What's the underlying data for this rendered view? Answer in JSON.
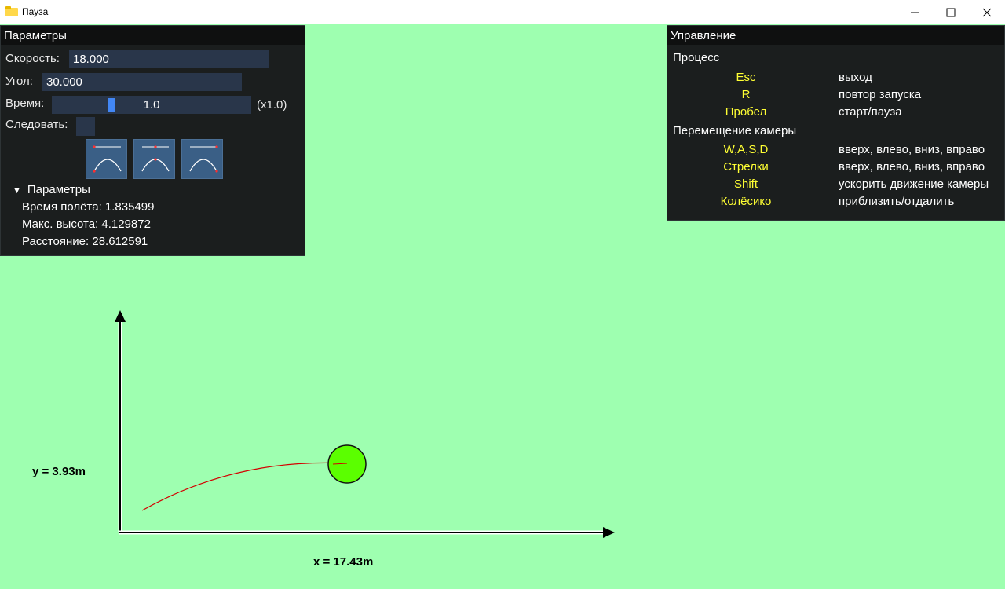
{
  "window": {
    "title": "Пауза",
    "icons": {
      "app": "folder-icon",
      "minimize": "minimize-icon",
      "maximize": "maximize-icon",
      "close": "close-icon"
    }
  },
  "params_panel": {
    "title": "Параметры",
    "speed": {
      "label": "Скорость:",
      "value": "18.000"
    },
    "angle": {
      "label": "Угол:",
      "value": "30.000"
    },
    "time": {
      "label": "Время:",
      "value": "1.0",
      "multiplier": "(x1.0)",
      "slider_fraction": 0.29
    },
    "follow": {
      "label": "Следовать:",
      "checked": false
    },
    "trajectory_buttons": [
      "trajectory-start-icon",
      "trajectory-apex-icon",
      "trajectory-end-icon"
    ],
    "stats": {
      "title": "Параметры",
      "flight_time": "Время полёта: 1.835499",
      "max_height": "Макс. высота: 4.129872",
      "distance": "Расстояние: 28.612591"
    }
  },
  "controls_panel": {
    "title": "Управление",
    "sections": [
      {
        "heading": "Процесс",
        "rows": [
          {
            "key": "Esc",
            "desc": "выход"
          },
          {
            "key": "R",
            "desc": "повтор запуска"
          },
          {
            "key": "Пробел",
            "desc": "старт/пауза"
          }
        ]
      },
      {
        "heading": "Перемещение камеры",
        "rows": [
          {
            "key": "W,A,S,D",
            "desc": "вверх, влево, вниз, вправо"
          },
          {
            "key": "Стрелки",
            "desc": "вверх, влево, вниз, вправо"
          },
          {
            "key": "Shift",
            "desc": "ускорить движение камеры"
          },
          {
            "key": "Колёсико",
            "desc": "приблизить/отдалить"
          }
        ]
      }
    ]
  },
  "scene": {
    "x_label": "x = 17.43m",
    "y_label": "y = 3.93m",
    "colors": {
      "background": "#9effb0",
      "ball": "#5bff00",
      "trajectory": "#d40000",
      "keys": "#ffff33"
    }
  }
}
